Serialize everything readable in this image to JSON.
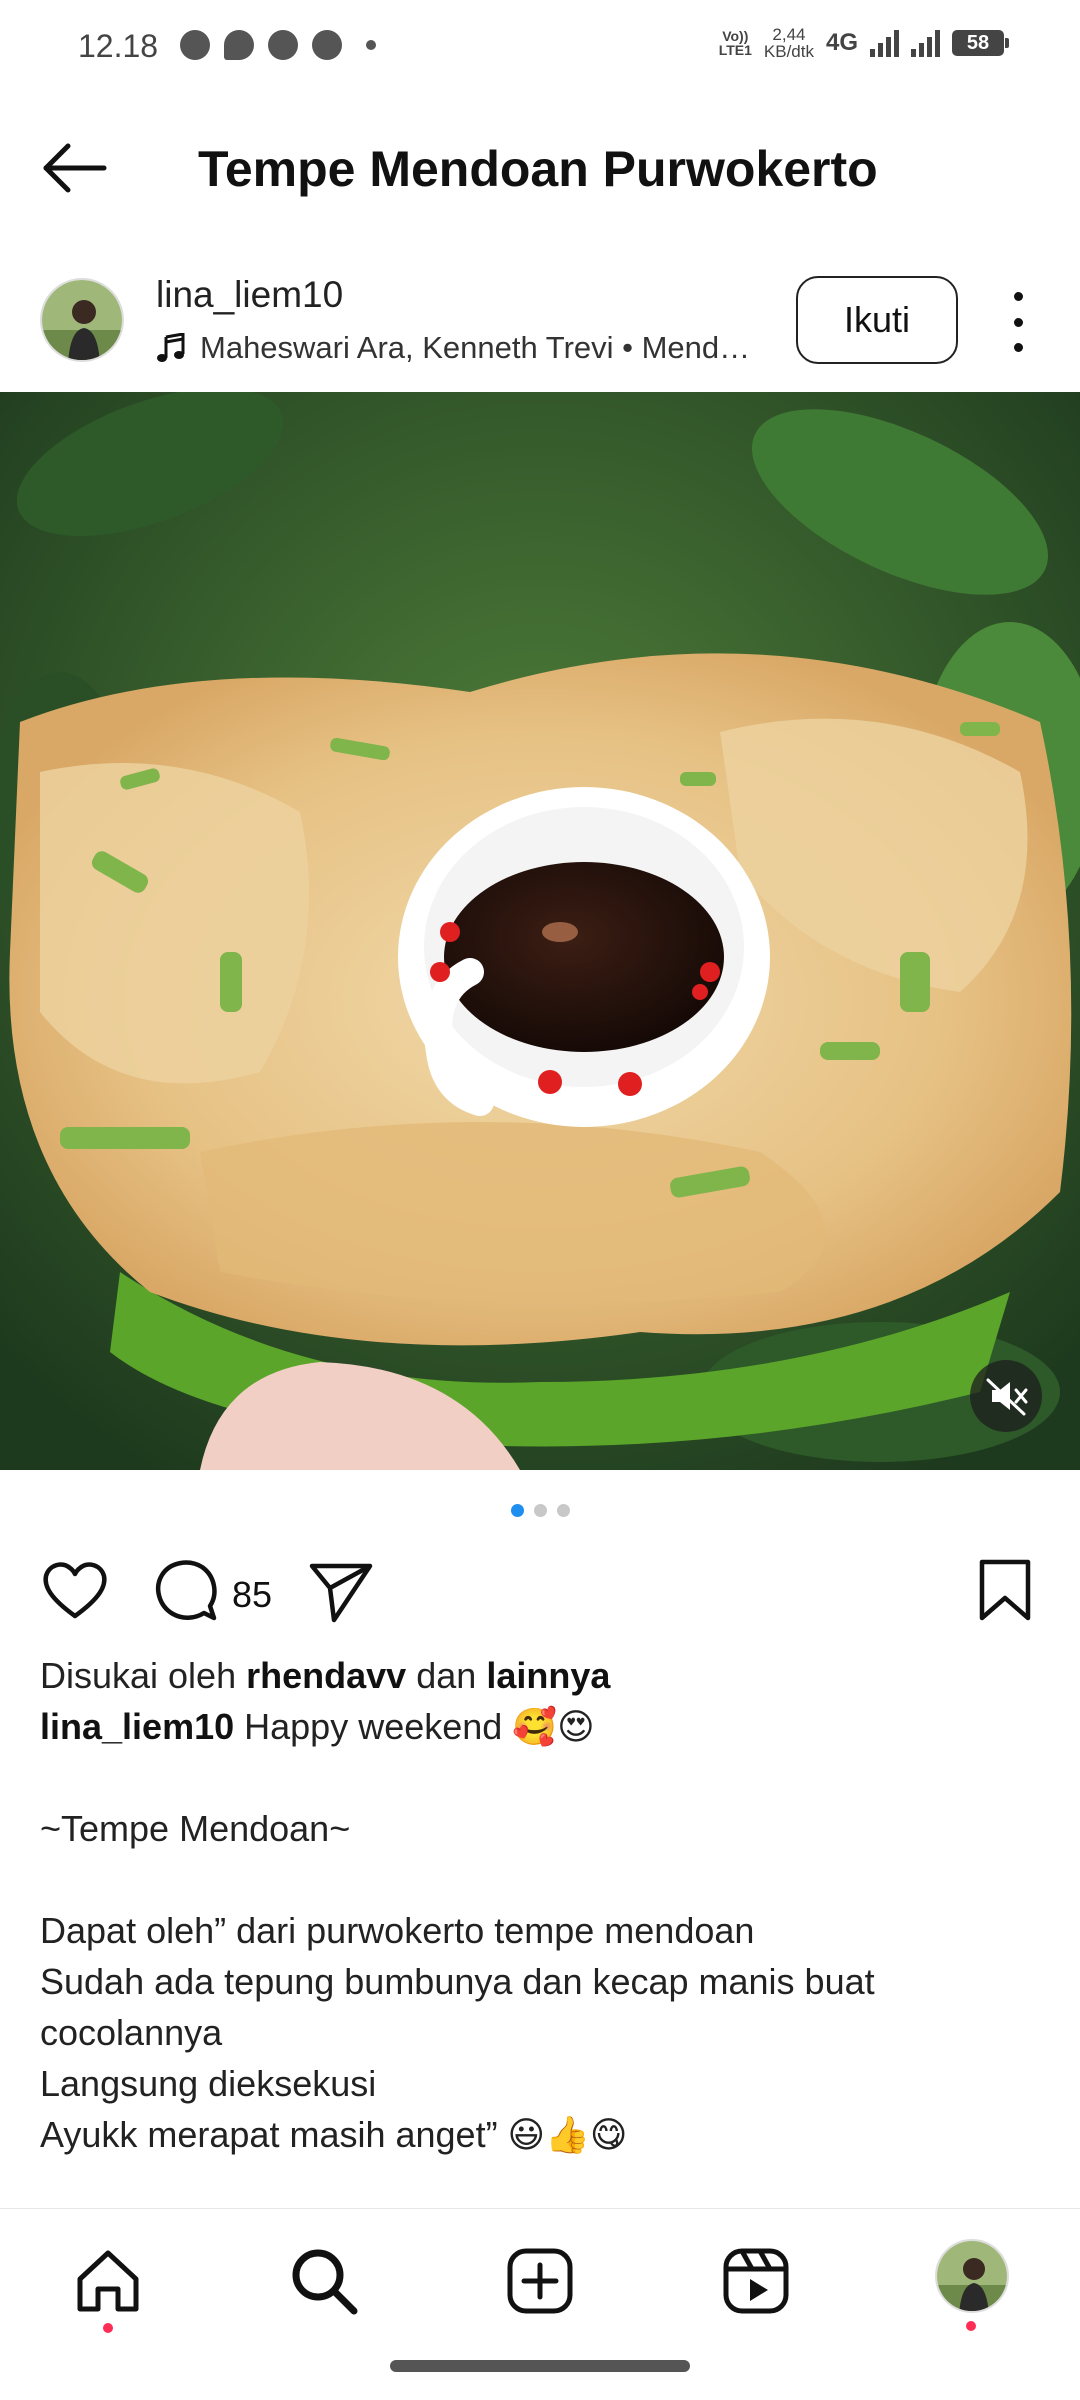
{
  "status_bar": {
    "time": "12.18",
    "volte": "Vo)) LTE1",
    "speed": "2,44 KB/dtk",
    "network": "4G",
    "battery": "58",
    "icons": [
      "whatsapp-icon",
      "message-icon",
      "facebook-icon",
      "compass-icon"
    ]
  },
  "header": {
    "title": "Tempe Mendoan Purwokerto",
    "back_icon": "arrow-left-icon"
  },
  "post": {
    "username": "lina_liem10",
    "audio": "Maheswari Ara, Kenneth Trevi • Mend…",
    "follow_label": "Ikuti",
    "photo_description_icon": "tempe-mendoan-photo"
  },
  "carousel": {
    "count": 3,
    "active_index": 0
  },
  "actions": {
    "comment_count": "85"
  },
  "caption": {
    "liked_prefix": "Disukai oleh",
    "liked_user": "rhendavv",
    "liked_connector": "dan",
    "liked_others": "lainnya",
    "author": "lina_liem10",
    "first_line": "Happy weekend 🥰😍",
    "title_line": "~Tempe Mendoan~",
    "line1": "Dapat oleh” dari purwokerto tempe mendoan",
    "line2": "Sudah ada tepung bumbunya dan kecap manis buat",
    "line3": "cocolannya",
    "line4": "Langsung dieksekusi",
    "line5": "Ayukk merapat masih anget” 😃👍😋"
  },
  "bottom_nav": {
    "items": [
      "home-icon",
      "search-icon",
      "create-icon",
      "reels-icon",
      "profile-avatar"
    ]
  },
  "colors": {
    "accent_blue": "#1e8ff0",
    "notification_red": "#ff2d55"
  }
}
